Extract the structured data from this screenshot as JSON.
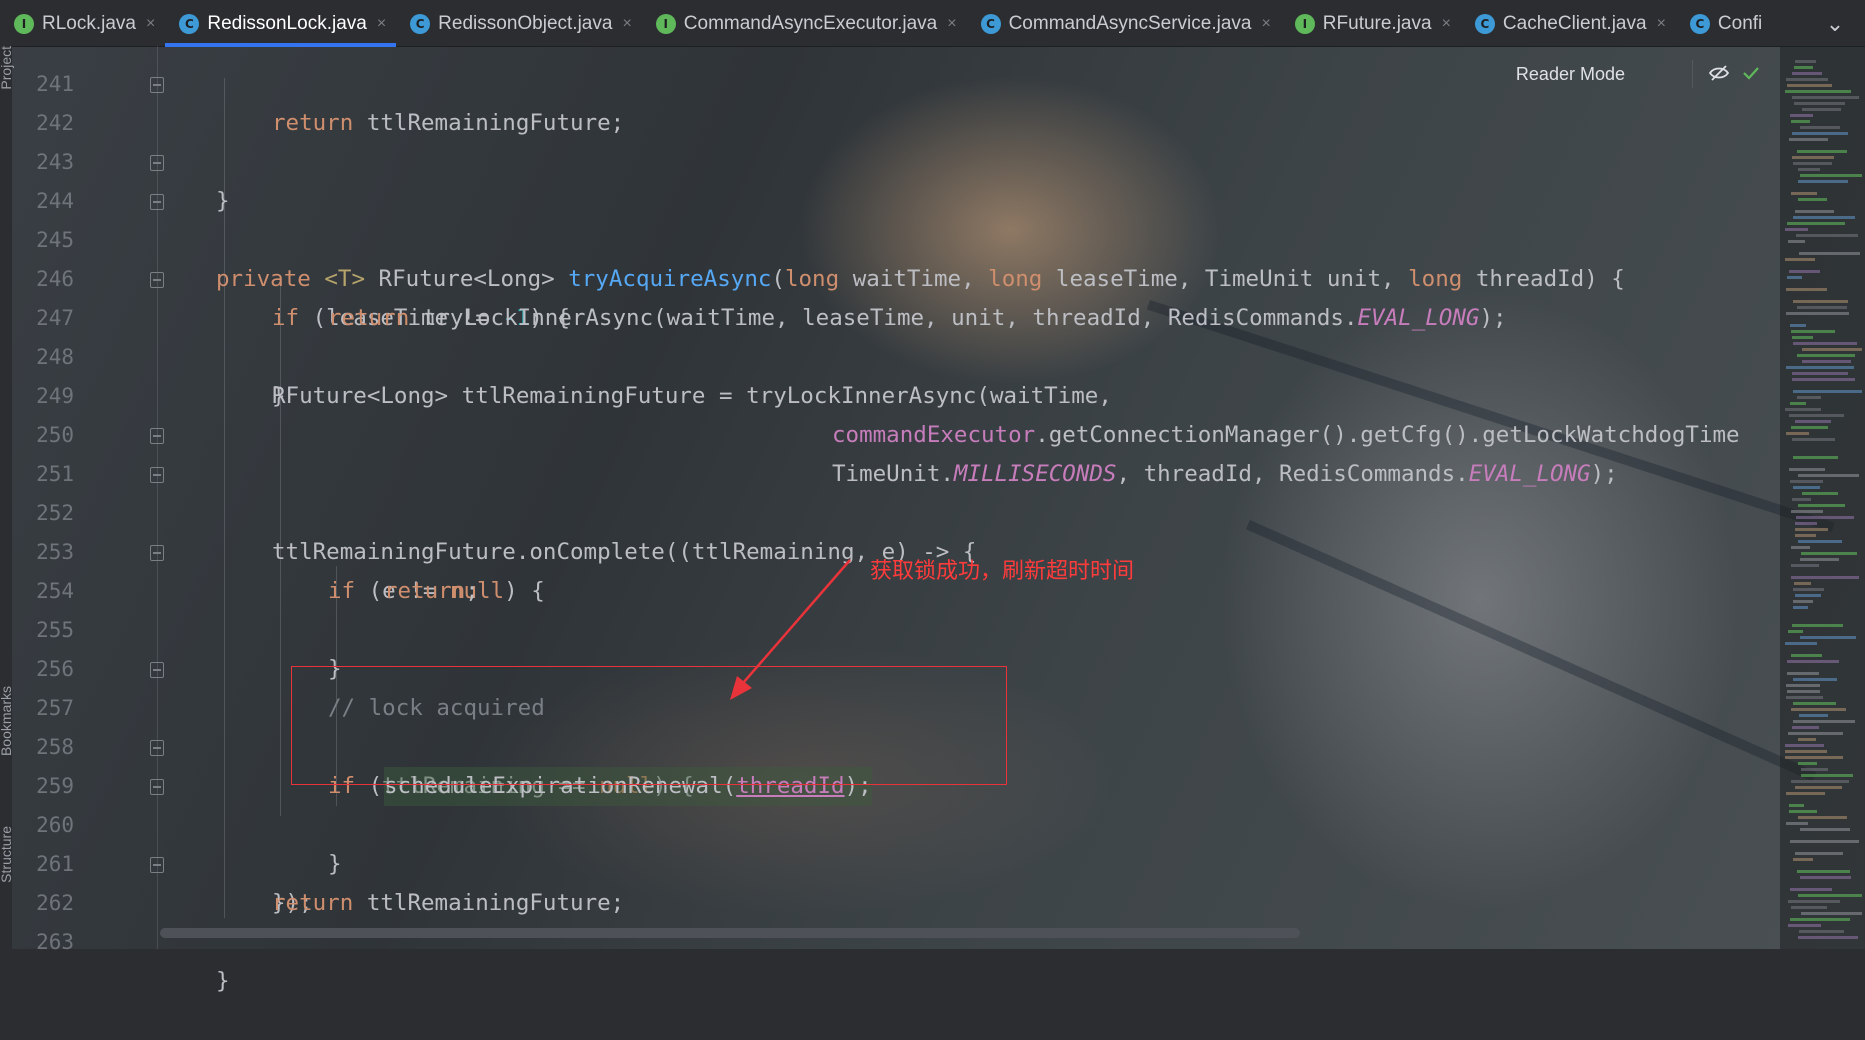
{
  "tabs": [
    {
      "label": "RLock.java",
      "kind": "I",
      "active": false
    },
    {
      "label": "RedissonLock.java",
      "kind": "C",
      "active": true
    },
    {
      "label": "RedissonObject.java",
      "kind": "C",
      "active": false
    },
    {
      "label": "CommandAsyncExecutor.java",
      "kind": "I",
      "active": false
    },
    {
      "label": "CommandAsyncService.java",
      "kind": "C",
      "active": false
    },
    {
      "label": "RFuture.java",
      "kind": "I",
      "active": false
    },
    {
      "label": "CacheClient.java",
      "kind": "C",
      "active": false
    },
    {
      "label": "Confi",
      "kind": "C",
      "active": false
    }
  ],
  "side_labels": {
    "project": "Project",
    "bookmarks": "Bookmarks",
    "structure": "Structure"
  },
  "reader_mode": "Reader Mode",
  "annotation": "获取锁成功，刷新超时时间",
  "line_numbers": [
    "241",
    "242",
    "243",
    "244",
    "245",
    "246",
    "247",
    "248",
    "249",
    "250",
    "251",
    "252",
    "253",
    "254",
    "255",
    "256",
    "257",
    "258",
    "259",
    "260",
    "261",
    "262",
    "263"
  ],
  "code": {
    "l241": {
      "kw": "return",
      "rest": " ttlRemainingFuture;"
    },
    "l242": {
      "brace": "}"
    },
    "l244": {
      "private": "private ",
      "gen": "<T>",
      "type1": " RFuture<Long> ",
      "name": "tryAcquireAsync",
      "p1kw": "long",
      "p1": " waitTime, ",
      "p2kw": "long",
      "p2": " leaseTime, TimeUnit unit, ",
      "p3kw": "long",
      "p3": " threadId) {"
    },
    "l245": {
      "kw": "if",
      "a": " (leaseTime != ",
      "num": "-1",
      "b": ") {"
    },
    "l246": {
      "kw": "return",
      "a": " tryLockInnerAsync(waitTime, leaseTime, unit, threadId, RedisCommands.",
      "st": "EVAL_LONG",
      "b": ");"
    },
    "l247": {
      "brace": "}"
    },
    "l248": {
      "text": "RFuture<Long> ttlRemainingFuture = tryLockInnerAsync(waitTime,"
    },
    "l249": {
      "field": "commandExecutor",
      "rest": ".getConnectionManager().getCfg().getLockWatchdogTime"
    },
    "l250": {
      "a": "TimeUnit.",
      "st1": "MILLISECONDS",
      "b": ", threadId, RedisCommands.",
      "st2": "EVAL_LONG",
      "c": ");"
    },
    "l251": {
      "text": "ttlRemainingFuture.onComplete((ttlRemaining, e) -> {"
    },
    "l252": {
      "kw": "if",
      "a": " (e != ",
      "kw2": "null",
      "b": ") {"
    },
    "l253": {
      "kw": "return",
      "rest": ";"
    },
    "l254": {
      "brace": "}"
    },
    "l256": {
      "comment": "// lock acquired"
    },
    "l257": {
      "kw": "if",
      "a": " (ttlRemaining == ",
      "kw2": "null",
      "b": ") {"
    },
    "l258": {
      "a": "scheduleExpirationRenewal(",
      "param": "threadId",
      "b": ");"
    },
    "l259": {
      "brace": "}"
    },
    "l260": {
      "text": "});"
    },
    "l261": {
      "kw": "return",
      "rest": " ttlRemainingFuture;"
    },
    "l262": {
      "brace": "}"
    }
  }
}
